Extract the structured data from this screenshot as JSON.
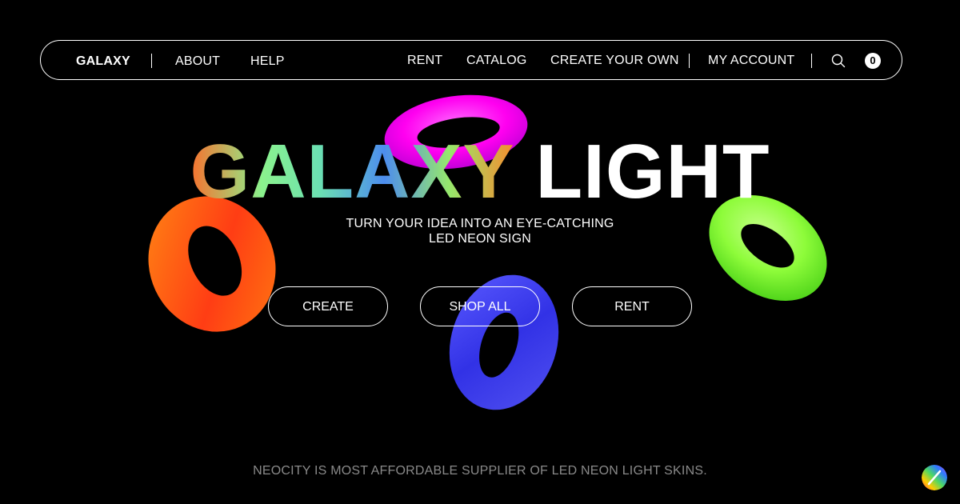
{
  "nav": {
    "brand": "GALAXY",
    "about": "ABOUT",
    "help": "HELP",
    "rent": "RENT",
    "catalog": "CATALOG",
    "create_your_own": "CREATE YOUR OWN",
    "my_account": "MY ACCOUNT",
    "cart_count": "0"
  },
  "hero": {
    "title_colored": "GALAXY",
    "title_white": "LIGHT",
    "subtitle_line1": "TURN YOUR IDEA INTO AN EYE-CATCHING",
    "subtitle_line2": "LED NEON SIGN"
  },
  "buttons": {
    "create": "CREATE",
    "shop_all": "SHOP ALL",
    "rent": "RENT"
  },
  "footer": {
    "tagline": "NEOCITY IS MOST AFFORDABLE SUPPLIER OF LED NEON LIGHT SKINS."
  },
  "icons": {
    "search": "search-icon",
    "corner_logo": "rainbow-logo-icon"
  },
  "colors": {
    "background": "#000000",
    "ring_magenta": "#ff00ff",
    "ring_orange": "#ff5a10",
    "ring_green": "#8dfc3c",
    "ring_blue": "#3c3cf0",
    "footer_text": "#8a8a8a"
  }
}
